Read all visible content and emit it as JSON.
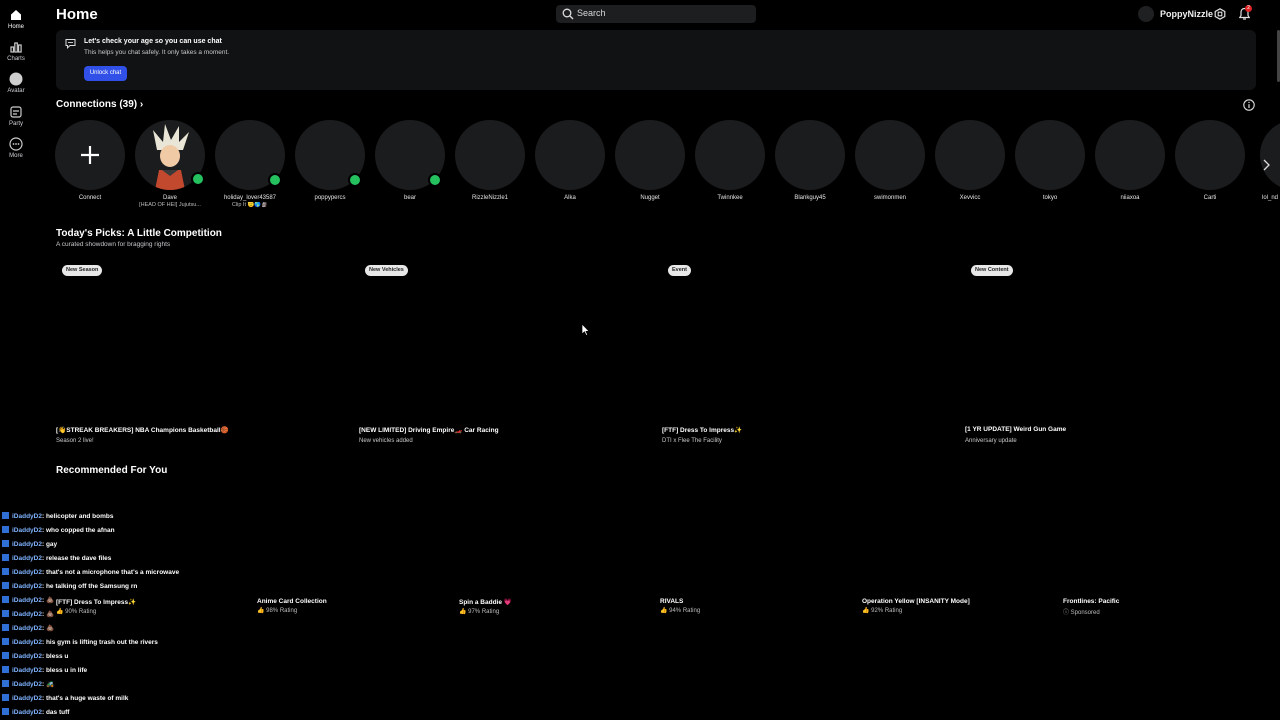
{
  "rail": [
    {
      "label": "Home",
      "icon": "home-icon"
    },
    {
      "label": "Charts",
      "icon": "charts-icon"
    },
    {
      "label": "Avatar",
      "icon": "avatar-icon"
    },
    {
      "label": "Party",
      "icon": "party-icon"
    },
    {
      "label": "More",
      "icon": "more-icon"
    }
  ],
  "header": {
    "title": "Home",
    "search_placeholder": "Search",
    "username": "PoppyNizzle",
    "notification_count": "2"
  },
  "banner": {
    "title": "Let's check your age so you can use chat",
    "subtitle": "This helps you chat safely. It only takes a moment.",
    "button": "Unlock chat"
  },
  "connections": {
    "title": "Connections (39)",
    "items": [
      {
        "name": "Connect",
        "status": ""
      },
      {
        "name": "Dave",
        "status": "[HEAD OF HEI] Jujutsu..."
      },
      {
        "name": "holiday_lover43587",
        "status": "Clip It 🫡🌎🗿"
      },
      {
        "name": "poppypercs",
        "status": ""
      },
      {
        "name": "bear",
        "status": ""
      },
      {
        "name": "RizzleNizzle1",
        "status": ""
      },
      {
        "name": "Alka",
        "status": ""
      },
      {
        "name": "Nugget",
        "status": ""
      },
      {
        "name": "Twinnkee",
        "status": ""
      },
      {
        "name": "Blankguy45",
        "status": ""
      },
      {
        "name": "swimonmen",
        "status": ""
      },
      {
        "name": "Xevvicc",
        "status": ""
      },
      {
        "name": "tokyo",
        "status": ""
      },
      {
        "name": "niiaxoa",
        "status": ""
      },
      {
        "name": "Carti",
        "status": ""
      },
      {
        "name": "lol_nd",
        "status": ""
      }
    ]
  },
  "picks": {
    "title": "Today's Picks: A Little Competition",
    "subtitle": "A curated showdown for bragging rights",
    "items": [
      {
        "tag": "New Season",
        "title": "[👋STREAK BREAKERS] NBA Champions Basketball🏀",
        "subtitle": "Season 2 live!"
      },
      {
        "tag": "New Vehicles",
        "title": "[NEW LIMITED] Driving Empire🏎️ Car Racing",
        "subtitle": "New vehicles added"
      },
      {
        "tag": "Event",
        "title": "[FTF] Dress To Impress✨",
        "subtitle": "DTI x Flee The Facility"
      },
      {
        "tag": "New Content",
        "title": "[1 YR UPDATE] Weird Gun Game",
        "subtitle": "Anniversary update"
      }
    ]
  },
  "recommended": {
    "title": "Recommended For You",
    "items": [
      {
        "title": "[FTF] Dress To Impress✨",
        "rating": "👍 90% Rating"
      },
      {
        "title": "Anime Card Collection",
        "rating": "👍 98% Rating"
      },
      {
        "title": "Spin a Baddie 💗",
        "rating": "👍 97% Rating"
      },
      {
        "title": "RIVALS",
        "rating": "👍 94% Rating"
      },
      {
        "title": "Operation Yellow [INSANITY Mode]",
        "rating": "👍 92% Rating"
      },
      {
        "title": "Frontlines: Pacific",
        "rating": "ⓘ Sponsored"
      }
    ]
  },
  "chat": [
    {
      "user": "iDaddyD2",
      "msg": ": helicopter and bombs"
    },
    {
      "user": "iDaddyD2",
      "msg": ": who copped the afnan"
    },
    {
      "user": "iDaddyD2",
      "msg": ": gay"
    },
    {
      "user": "iDaddyD2",
      "msg": ": release the dave files"
    },
    {
      "user": "iDaddyD2",
      "msg": ": that's not a microphone that's a microwave"
    },
    {
      "user": "iDaddyD2",
      "msg": ": he talking off the Samsung rn"
    },
    {
      "user": "iDaddyD2",
      "msg": ": 💩"
    },
    {
      "user": "iDaddyD2",
      "msg": ": 💩"
    },
    {
      "user": "iDaddyD2",
      "msg": ": 💩"
    },
    {
      "user": "iDaddyD2",
      "msg": ": his gym is lifting trash out the rivers"
    },
    {
      "user": "iDaddyD2",
      "msg": ": bless u"
    },
    {
      "user": "iDaddyD2",
      "msg": ": bless u in life"
    },
    {
      "user": "iDaddyD2",
      "msg": ": 🚜"
    },
    {
      "user": "iDaddyD2",
      "msg": ": that's a huge waste of milk"
    },
    {
      "user": "iDaddyD2",
      "msg": ": das tuff"
    }
  ],
  "colors": {
    "accent": "#3150e7",
    "online": "#26c15f",
    "badge": "#e02424"
  }
}
